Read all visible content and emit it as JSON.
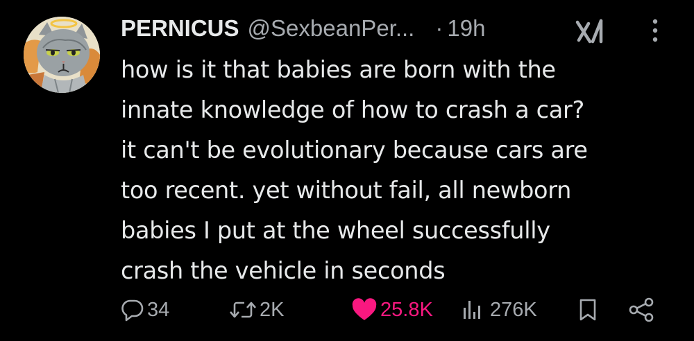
{
  "author": {
    "display_name": "PERNICUS",
    "handle": "@SexbeanPer...",
    "separator": "·",
    "time": "19h",
    "avatar": "gray-cat-with-halo-painting"
  },
  "tweet": {
    "lines": [
      "how is it that babies are born with the",
      "innate knowledge of how to crash a car?",
      "it can't be evolutionary because cars are",
      "too recent. yet without fail, all newborn",
      "babies I put at the wheel successfully",
      "crash the vehicle in seconds"
    ]
  },
  "actions": {
    "replies": "34",
    "reposts": "2K",
    "likes": "25.8K",
    "views": "276K"
  },
  "icons": {
    "reply": "reply-icon",
    "repost": "repost-icon",
    "like": "heart-icon",
    "views": "views-icon",
    "bookmark": "bookmark-icon",
    "share": "share-icon",
    "grok": "grok-icon",
    "more": "more-icon"
  },
  "colors": {
    "background": "#000000",
    "text": "#e7e9ea",
    "secondary": "#a7abb0",
    "like": "#f91880"
  }
}
